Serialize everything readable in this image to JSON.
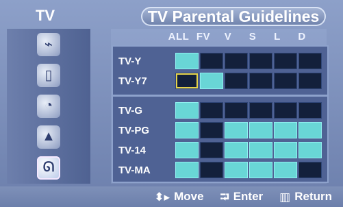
{
  "header": {
    "left_tab": "TV",
    "title": "TV Parental Guidelines"
  },
  "columns": [
    "ALL",
    "FV",
    "V",
    "S",
    "L",
    "D"
  ],
  "groups": [
    {
      "rows": [
        {
          "label": "TV-Y",
          "cells": [
            true,
            false,
            false,
            false,
            false,
            false
          ]
        },
        {
          "label": "TV-Y7",
          "cells": [
            false,
            true,
            false,
            false,
            false,
            false
          ]
        }
      ]
    },
    {
      "rows": [
        {
          "label": "TV-G",
          "cells": [
            true,
            false,
            false,
            false,
            false,
            false
          ]
        },
        {
          "label": "TV-PG",
          "cells": [
            true,
            false,
            true,
            true,
            true,
            true
          ]
        },
        {
          "label": "TV-14",
          "cells": [
            true,
            false,
            true,
            true,
            true,
            true
          ]
        },
        {
          "label": "TV-MA",
          "cells": [
            true,
            false,
            true,
            true,
            true,
            false
          ]
        }
      ]
    }
  ],
  "focus": {
    "row": "TV-Y7",
    "column": "ALL"
  },
  "footer": {
    "move": "Move",
    "enter": "Enter",
    "return": "Return"
  },
  "sidebar_icons": [
    "antenna-icon",
    "tv-icon",
    "speaker-icon",
    "mountain-icon",
    "ribbon-icon"
  ]
}
